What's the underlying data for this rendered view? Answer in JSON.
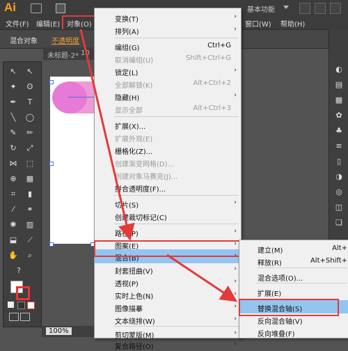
{
  "app": {
    "logo": "Ai",
    "workspace": "基本功能"
  },
  "menubar": {
    "items": [
      "文件(F)",
      "编辑(E)",
      "对象(O)",
      "窗口(W)",
      "帮助(H)"
    ]
  },
  "control_bar": {
    "selection_label": "混合对象",
    "opacity_label": "不透明度"
  },
  "document_tab": {
    "title": "未标题-2*",
    "zoom": "10"
  },
  "status": {
    "zoom": "100%"
  },
  "object_menu": {
    "items": [
      {
        "label": "变换(T)",
        "submenu": true
      },
      {
        "label": "排列(A)",
        "submenu": true
      },
      {
        "label": "编组(G)",
        "shortcut": "Ctrl+G"
      },
      {
        "label": "取消编组(U)",
        "shortcut": "Shift+Ctrl+G",
        "disabled": true
      },
      {
        "label": "锁定(L)",
        "submenu": true
      },
      {
        "label": "全部解锁(K)",
        "shortcut": "Alt+Ctrl+2",
        "disabled": true
      },
      {
        "label": "隐藏(H)",
        "submenu": true
      },
      {
        "label": "显示全部",
        "shortcut": "Alt+Ctrl+3",
        "disabled": true
      },
      {
        "label": "扩展(X)..."
      },
      {
        "label": "扩展外观(E)",
        "disabled": true
      },
      {
        "label": "栅格化(Z)..."
      },
      {
        "label": "创建渐变网格(D)...",
        "disabled": true
      },
      {
        "label": "创建对象马赛克(J)...",
        "disabled": true
      },
      {
        "label": "拼合透明度(F)..."
      },
      {
        "label": "切片(S)",
        "submenu": true
      },
      {
        "label": "创建裁切标记(C)"
      },
      {
        "label": "路径(P)",
        "submenu": true
      },
      {
        "label": "图案(E)",
        "submenu": true
      },
      {
        "label": "混合(B)",
        "submenu": true,
        "highlighted": true
      },
      {
        "label": "封套扭曲(V)",
        "submenu": true
      },
      {
        "label": "透视(P)",
        "submenu": true
      },
      {
        "label": "实时上色(N)",
        "submenu": true
      },
      {
        "label": "图像描摹",
        "submenu": true
      },
      {
        "label": "文本绕排(W)",
        "submenu": true
      },
      {
        "label": "剪切蒙版(M)",
        "submenu": true
      },
      {
        "label": "复合路径(O)",
        "submenu": true
      }
    ]
  },
  "blend_submenu": {
    "items": [
      {
        "label": "建立(M)",
        "shortcut": "Alt+"
      },
      {
        "label": "释放(R)",
        "shortcut": "Alt+Shift+"
      },
      {
        "label": "混合选项(O)..."
      },
      {
        "label": "扩展(E)"
      },
      {
        "label": "替换混合轴(S)",
        "highlighted": true
      },
      {
        "label": "反向混合轴(V)"
      },
      {
        "label": "反向堆叠(F)"
      }
    ]
  },
  "colors": {
    "highlight": "#93c5f0",
    "annotation_red": "#e43a3a",
    "logo": "#f7a21b",
    "shape_pink": "#e77ad6"
  }
}
